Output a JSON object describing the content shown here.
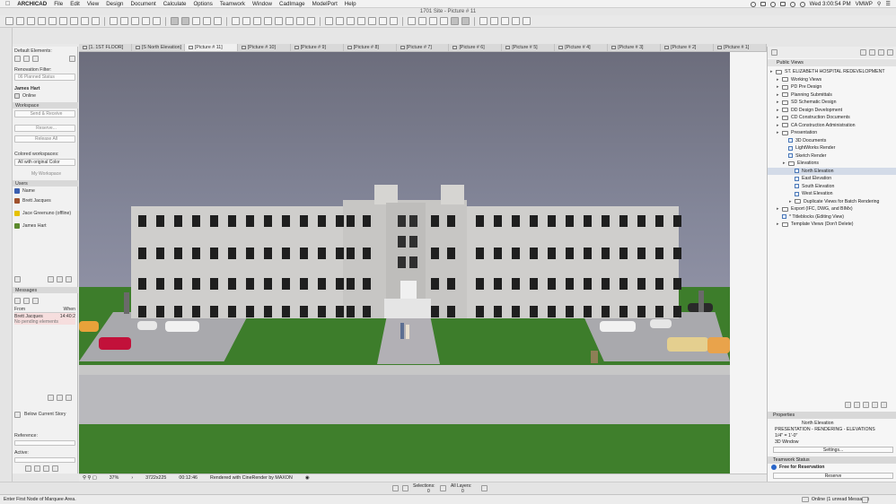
{
  "menubar": {
    "app": "ARCHICAD",
    "menus": [
      "File",
      "Edit",
      "View",
      "Design",
      "Document",
      "Calculate",
      "Options",
      "Teamwork",
      "Window",
      "CadImage",
      "ModelPort",
      "Help"
    ],
    "clock": "Wed 3:00:54 PM",
    "user": "VMWP"
  },
  "window": {
    "title": "1701 Site - Picture # 11"
  },
  "tabs": [
    {
      "label": "[1. 1ST FLOOR]",
      "active": false
    },
    {
      "label": "[S North Elevation]",
      "active": false
    },
    {
      "label": "[Picture # 11]",
      "active": true
    },
    {
      "label": "[Picture # 10]",
      "active": false
    },
    {
      "label": "[Picture # 9]",
      "active": false
    },
    {
      "label": "[Picture # 8]",
      "active": false
    },
    {
      "label": "[Picture # 7]",
      "active": false
    },
    {
      "label": "[Picture # 6]",
      "active": false
    },
    {
      "label": "[Picture # 5]",
      "active": false
    },
    {
      "label": "[Picture # 4]",
      "active": false
    },
    {
      "label": "[Picture # 3]",
      "active": false
    },
    {
      "label": "[Picture # 2]",
      "active": false
    },
    {
      "label": "[Picture # 1]",
      "active": false
    }
  ],
  "left": {
    "default_elements": "Default Elements:",
    "renovation_filter": "Renovation Filter:",
    "renovation_value": "06 Planned Status",
    "user_name": "James Hart",
    "online": "Online",
    "workspace": "Workspace",
    "send_receive": "Send & Receive",
    "reserve": "Reserve...",
    "release_all": "Release All",
    "colored_workspaces": "Colored workspaces:",
    "all_original": "All with original Color",
    "my_workspace": "My Workspace",
    "users_header": "Users",
    "users": [
      {
        "name": "Name",
        "color": "#3a5fb0"
      },
      {
        "name": "Brett Jacques",
        "color": "#a0522d"
      },
      {
        "name": "Jace Greenuno (offline)",
        "color": "#e6c200"
      },
      {
        "name": "James Hart",
        "color": "#5c8a2e"
      }
    ],
    "messages_header": "Messages",
    "msg_from": "From",
    "msg_when": "When",
    "msg_sender": "Brett Jacques",
    "msg_time": "14:40:2",
    "msg_text": "No pending elements",
    "below_story": "Below Current Story",
    "reference": "Reference:",
    "active": "Active:"
  },
  "infobar": {
    "zoom": "37%",
    "size": "3722x225",
    "time": "00:12:46",
    "render_note": "Rendered with CineRender by MAXON"
  },
  "lowerbar": {
    "selections": "Selections:",
    "all_layers": "All Layers:",
    "count": "0"
  },
  "navigator": {
    "header": "Public Views",
    "tree": [
      {
        "label": "ST. ELIZABETH HOSPITAL REDEVELOPMENT",
        "indent": 0,
        "type": "project"
      },
      {
        "label": "Working Views",
        "indent": 1,
        "type": "folder"
      },
      {
        "label": "PD Pre Design",
        "indent": 1,
        "type": "folder"
      },
      {
        "label": "Planning Submittals",
        "indent": 1,
        "type": "folder"
      },
      {
        "label": "SD Schematic Design",
        "indent": 1,
        "type": "folder"
      },
      {
        "label": "DD Design Development",
        "indent": 1,
        "type": "folder"
      },
      {
        "label": "CD Construction Documents",
        "indent": 1,
        "type": "folder"
      },
      {
        "label": "CA Construction Administration",
        "indent": 1,
        "type": "folder"
      },
      {
        "label": "Presentation",
        "indent": 1,
        "type": "folder"
      },
      {
        "label": "3D Documents",
        "indent": 2,
        "type": "view"
      },
      {
        "label": "LightWorks Render",
        "indent": 2,
        "type": "view"
      },
      {
        "label": "Sketch Render",
        "indent": 2,
        "type": "view"
      },
      {
        "label": "Elevations",
        "indent": 2,
        "type": "folder"
      },
      {
        "label": "North Elevation",
        "indent": 3,
        "type": "view",
        "selected": true
      },
      {
        "label": "East Elevation",
        "indent": 3,
        "type": "view"
      },
      {
        "label": "South Elevation",
        "indent": 3,
        "type": "view"
      },
      {
        "label": "West Elevation",
        "indent": 3,
        "type": "view"
      },
      {
        "label": "Duplicate Views for Batch Rendering",
        "indent": 3,
        "type": "folder"
      },
      {
        "label": "Export (IFC, DWG, and BIMx)",
        "indent": 1,
        "type": "folder"
      },
      {
        "label": "* Titleblocks (Editing View)",
        "indent": 1,
        "type": "view"
      },
      {
        "label": "Template Views (Don't Delete)",
        "indent": 1,
        "type": "folder"
      }
    ],
    "properties_header": "Properties",
    "prop_name": "North Elevation",
    "prop_path": "PRESENTATION - RENDERING - ELEVATIONS",
    "prop_scale": "1/4\" = 1'-0\"",
    "prop_window": "3D Window",
    "settings": "Settings...",
    "teamwork_header": "Teamwork Status",
    "free_reservation": "Free for Reservation",
    "reserve": "Reserve"
  },
  "status": {
    "hint": "Enter First Node of Marquee Area.",
    "online_msg": "Online (1 unread Message)"
  }
}
